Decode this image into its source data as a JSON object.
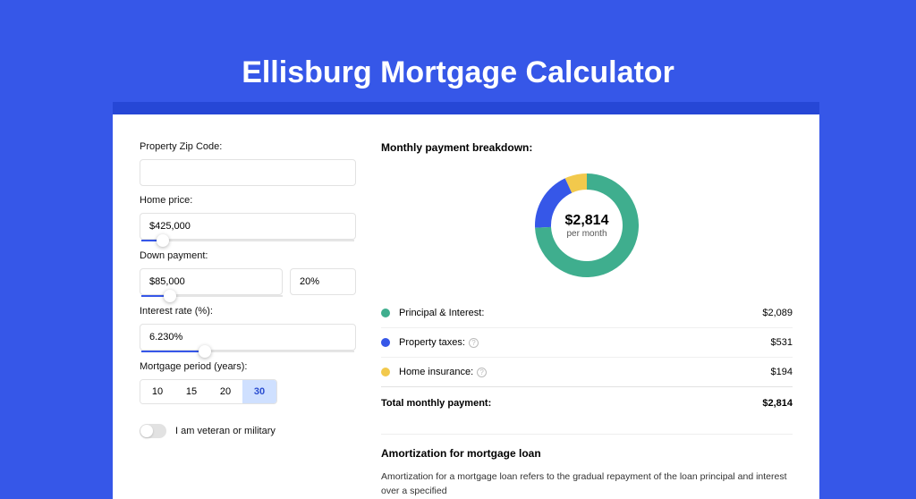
{
  "page_title": "Ellisburg Mortgage Calculator",
  "form": {
    "zip_label": "Property Zip Code:",
    "zip_value": "",
    "price_label": "Home price:",
    "price_value": "$425,000",
    "price_slider_pct": 10,
    "down_label": "Down payment:",
    "down_value": "$85,000",
    "down_pct_value": "20%",
    "down_slider_pct": 20,
    "rate_label": "Interest rate (%):",
    "rate_value": "6.230%",
    "rate_slider_pct": 30,
    "period_label": "Mortgage period (years):",
    "periods": [
      "10",
      "15",
      "20",
      "30"
    ],
    "period_selected": "30",
    "veteran_label": "I am veteran or military"
  },
  "breakdown": {
    "title": "Monthly payment breakdown:",
    "total_amount": "$2,814",
    "total_sub": "per month",
    "items": [
      {
        "label": "Principal & Interest:",
        "amount": "$2,089",
        "color": "#3fae8e"
      },
      {
        "label": "Property taxes:",
        "amount": "$531",
        "color": "#3657e8",
        "info": true
      },
      {
        "label": "Home insurance:",
        "amount": "$194",
        "color": "#f2c94c",
        "info": true
      }
    ],
    "total_label": "Total monthly payment:",
    "total_value": "$2,814"
  },
  "amort": {
    "title": "Amortization for mortgage loan",
    "text": "Amortization for a mortgage loan refers to the gradual repayment of the loan principal and interest over a specified"
  },
  "chart_data": {
    "type": "pie",
    "title": "Monthly payment breakdown",
    "series": [
      {
        "name": "Principal & Interest",
        "value": 2089,
        "color": "#3fae8e"
      },
      {
        "name": "Property taxes",
        "value": 531,
        "color": "#3657e8"
      },
      {
        "name": "Home insurance",
        "value": 194,
        "color": "#f2c94c"
      }
    ],
    "total": 2814
  }
}
